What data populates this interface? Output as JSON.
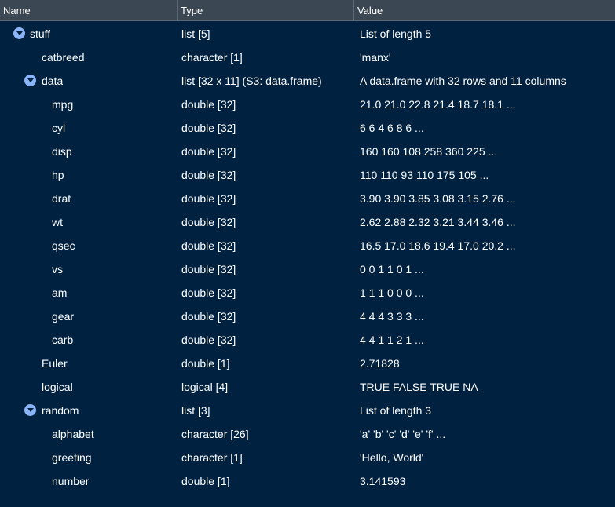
{
  "header": {
    "name": "Name",
    "type": "Type",
    "value": "Value"
  },
  "rows": [
    {
      "name": "stuff",
      "type": "list [5]",
      "value": "List of length 5"
    },
    {
      "name": "catbreed",
      "type": "character [1]",
      "value": "'manx'"
    },
    {
      "name": "data",
      "type": "list [32 x 11] (S3: data.frame)",
      "value": "A data.frame with 32 rows and 11 columns"
    },
    {
      "name": "mpg",
      "type": "double [32]",
      "value": "21.0 21.0 22.8 21.4 18.7 18.1 ..."
    },
    {
      "name": "cyl",
      "type": "double [32]",
      "value": "6 6 4 6 8 6 ..."
    },
    {
      "name": "disp",
      "type": "double [32]",
      "value": "160 160 108 258 360 225 ..."
    },
    {
      "name": "hp",
      "type": "double [32]",
      "value": "110 110 93 110 175 105 ..."
    },
    {
      "name": "drat",
      "type": "double [32]",
      "value": "3.90 3.90 3.85 3.08 3.15 2.76 ..."
    },
    {
      "name": "wt",
      "type": "double [32]",
      "value": "2.62 2.88 2.32 3.21 3.44 3.46 ..."
    },
    {
      "name": "qsec",
      "type": "double [32]",
      "value": "16.5 17.0 18.6 19.4 17.0 20.2 ..."
    },
    {
      "name": "vs",
      "type": "double [32]",
      "value": "0 0 1 1 0 1 ..."
    },
    {
      "name": "am",
      "type": "double [32]",
      "value": "1 1 1 0 0 0 ..."
    },
    {
      "name": "gear",
      "type": "double [32]",
      "value": "4 4 4 3 3 3 ..."
    },
    {
      "name": "carb",
      "type": "double [32]",
      "value": "4 4 1 1 2 1 ..."
    },
    {
      "name": "Euler",
      "type": "double [1]",
      "value": "2.71828"
    },
    {
      "name": "logical",
      "type": "logical [4]",
      "value": "TRUE FALSE TRUE NA"
    },
    {
      "name": "random",
      "type": "list [3]",
      "value": "List of length 3"
    },
    {
      "name": "alphabet",
      "type": "character [26]",
      "value": "'a' 'b' 'c' 'd' 'e' 'f' ..."
    },
    {
      "name": "greeting",
      "type": "character [1]",
      "value": "'Hello, World'"
    },
    {
      "name": "number",
      "type": "double [1]",
      "value": "3.141593"
    }
  ]
}
